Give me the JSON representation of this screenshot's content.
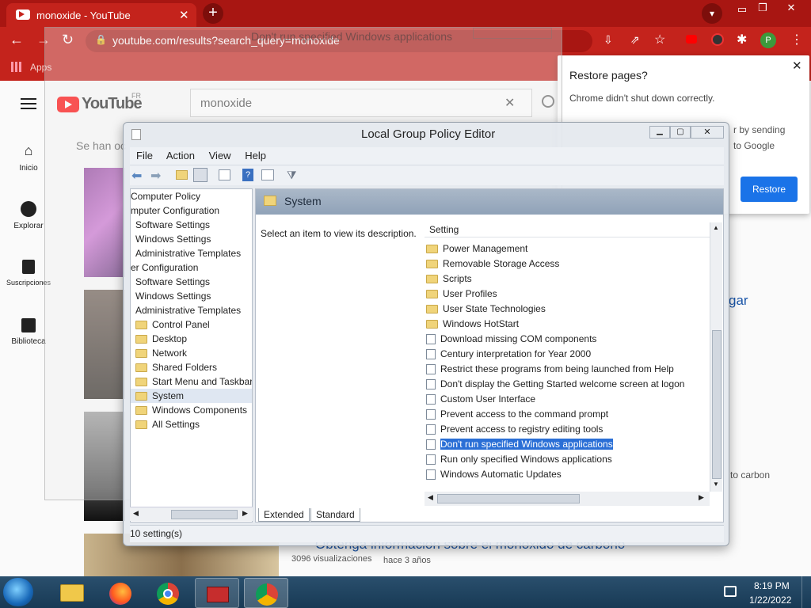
{
  "browser": {
    "tab_title": "monoxide - YouTube",
    "url": "youtube.com/results?search_query=monoxide",
    "profile_initial": "P",
    "bookmarks_apps": "Apps",
    "window_controls": [
      "minimize-icon",
      "restore-icon",
      "close-icon"
    ]
  },
  "youtube": {
    "logo": "YouTube",
    "region": "FR",
    "search_value": "monoxide",
    "nav": [
      "Inicio",
      "Explorar",
      "Suscripciones",
      "Biblioteca"
    ],
    "partial_notice": "Se han oc",
    "partial_title": "gar",
    "partial_desc": "to carbon",
    "video_title": "Obtenga información sobre el monóxido de carbono",
    "video_views": "3096 visualizaciones",
    "video_age": "hace 3 años"
  },
  "restore_popup": {
    "title": "Restore pages?",
    "message": "Chrome didn't shut down correctly.",
    "extra_line1": "r by sending",
    "extra_line2": "to Google",
    "button": "Restore"
  },
  "ghost_window": {
    "title": "Don't run specified Windows applications"
  },
  "gpedit": {
    "title": "Local Group Policy Editor",
    "menu": [
      "File",
      "Action",
      "View",
      "Help"
    ],
    "tree": [
      {
        "label": "Computer Policy",
        "indent": 0,
        "folder": false
      },
      {
        "label": "mputer Configuration",
        "indent": 0,
        "folder": false
      },
      {
        "label": "Software Settings",
        "indent": 1,
        "folder": false
      },
      {
        "label": "Windows Settings",
        "indent": 1,
        "folder": false
      },
      {
        "label": "Administrative Templates",
        "indent": 1,
        "folder": false
      },
      {
        "label": "er Configuration",
        "indent": 0,
        "folder": false
      },
      {
        "label": "Software Settings",
        "indent": 1,
        "folder": false
      },
      {
        "label": "Windows Settings",
        "indent": 1,
        "folder": false
      },
      {
        "label": "Administrative Templates",
        "indent": 1,
        "folder": false
      },
      {
        "label": "Control Panel",
        "indent": 1,
        "folder": true
      },
      {
        "label": "Desktop",
        "indent": 1,
        "folder": true
      },
      {
        "label": "Network",
        "indent": 1,
        "folder": true
      },
      {
        "label": "Shared Folders",
        "indent": 1,
        "folder": true
      },
      {
        "label": "Start Menu and Taskbar",
        "indent": 1,
        "folder": true
      },
      {
        "label": "System",
        "indent": 1,
        "folder": true
      },
      {
        "label": "Windows Components",
        "indent": 1,
        "folder": true
      },
      {
        "label": "All Settings",
        "indent": 1,
        "folder": true
      }
    ],
    "header_title": "System",
    "description": "Select an item to view its description.",
    "setting_column": "Setting",
    "settings": [
      {
        "label": "Power Management",
        "type": "folder"
      },
      {
        "label": "Removable Storage Access",
        "type": "folder"
      },
      {
        "label": "Scripts",
        "type": "folder"
      },
      {
        "label": "User Profiles",
        "type": "folder"
      },
      {
        "label": "User State Technologies",
        "type": "folder"
      },
      {
        "label": "Windows HotStart",
        "type": "folder"
      },
      {
        "label": "Download missing COM components",
        "type": "policy"
      },
      {
        "label": "Century interpretation for Year 2000",
        "type": "policy"
      },
      {
        "label": "Restrict these programs from being launched from Help",
        "type": "policy"
      },
      {
        "label": "Don't display the Getting Started welcome screen at logon",
        "type": "policy"
      },
      {
        "label": "Custom User Interface",
        "type": "policy"
      },
      {
        "label": "Prevent access to the command prompt",
        "type": "policy"
      },
      {
        "label": "Prevent access to registry editing tools",
        "type": "policy"
      },
      {
        "label": "Don't run specified Windows applications",
        "type": "policy",
        "selected": true
      },
      {
        "label": "Run only specified Windows applications",
        "type": "policy"
      },
      {
        "label": "Windows Automatic Updates",
        "type": "policy"
      }
    ],
    "tabs": [
      "Extended",
      "Standard"
    ],
    "status": "10 setting(s)"
  },
  "taskbar": {
    "time": "8:19 PM",
    "date": "1/22/2022"
  },
  "colors": {
    "chrome_red": "#c4231c",
    "yt_red": "#ff0000",
    "selection": "#2a6fd6",
    "restore_button": "#1a73e8"
  }
}
